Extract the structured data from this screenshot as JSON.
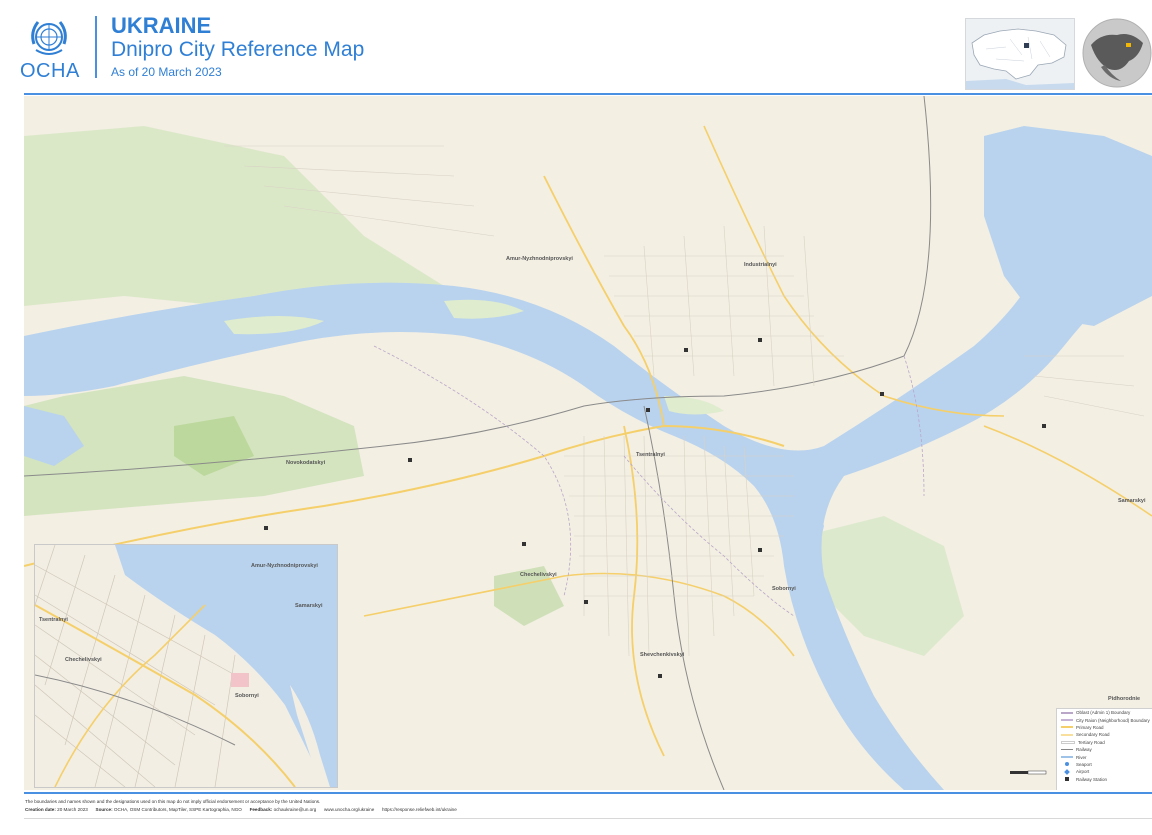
{
  "header": {
    "org_name": "OCHA",
    "country": "UKRAINE",
    "title": "Dnipro City Reference Map",
    "date": "As of 20 March 2023"
  },
  "colors": {
    "accent": "#2f7fd5",
    "water": "#b9d3ee",
    "land": "#f3efe3",
    "green": "#d6e6c4",
    "primary_road": "#f5cf6a"
  },
  "map_labels": {
    "amur_nyzhnodniprovskyi": "Amur-Nyzhnodniprovskyi",
    "industrialnyi": "Industrialnyi",
    "novokodatskyi": "Novokodatskyi",
    "tsentralnyi": "Tsentralnyi",
    "chechelivskyi": "Chechelivskyi",
    "sobornyi": "Sobornyi",
    "shevchenkivskyi": "Shevchenkivskyi",
    "samarskyi": "Samarskyi",
    "pidhorodnie": "Pidhorodnie"
  },
  "inset_labels": {
    "amur_nyzhnodniprovskyi": "Amur-Nyzhnodniprovskyi",
    "samarskyi": "Samarskyi",
    "tsentralnyi": "Tsentralnyi",
    "chechelivskyi": "Chechelivskyi",
    "sobornyi": "Sobornyi"
  },
  "legend": {
    "items": [
      {
        "label": "Oblast (Admin 1) Boundary",
        "color": "#b9a6c9"
      },
      {
        "label": "City Raion (Neighborhood) Boundary",
        "color": "#c7b3d6"
      },
      {
        "label": "Primary Road",
        "color": "#f5cf6a"
      },
      {
        "label": "Secondary Road",
        "color": "#f8e09c"
      },
      {
        "label": "Tertiary Road",
        "color": "#ffffff"
      },
      {
        "label": "Railway",
        "color": "#888888"
      },
      {
        "label": "River",
        "color": "#9fc3e8"
      },
      {
        "label": "Seaport",
        "color": "#4a90e2"
      },
      {
        "label": "Airport",
        "color": "#4a90e2"
      },
      {
        "label": "Railway Station",
        "color": "#333333"
      }
    ]
  },
  "footer": {
    "disclaimer": "The boundaries and names shown and the designations used on this map do not imply official endorsement or acceptance by the United Nations.",
    "creation_label": "Creation date:",
    "creation_value": "20 March 2023",
    "source_label": "Source:",
    "source_value": "OCHA, OSM Contributors, MapTiler, SSPE Kartographia, NGO",
    "feedback_label": "Feedback:",
    "feedback_value": "ochaukraine@un.org",
    "link1": "www.unocha.org/ukraine",
    "link2": "https://response.reliefweb.int/ukraine"
  }
}
